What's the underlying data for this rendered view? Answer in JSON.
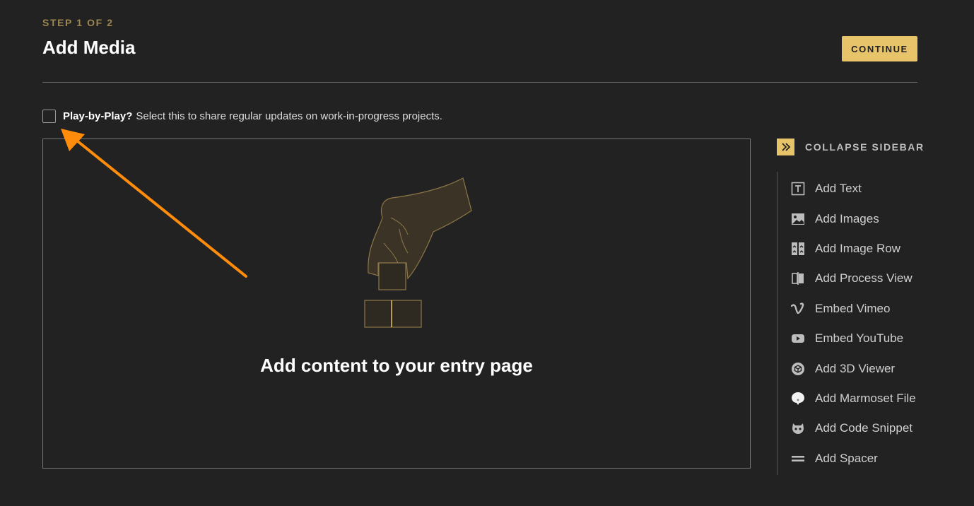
{
  "header": {
    "step": "STEP 1 OF 2",
    "title": "Add Media",
    "continue_label": "CONTINUE"
  },
  "play_by_play": {
    "label": "Play-by-Play?",
    "description": "Select this to share regular updates on work-in-progress projects.",
    "checked": false
  },
  "main": {
    "empty_text": "Add content to your entry page"
  },
  "sidebar": {
    "collapse_label": "COLLAPSE SIDEBAR",
    "items": [
      {
        "label": "Add Text",
        "icon": "text-icon"
      },
      {
        "label": "Add Images",
        "icon": "image-icon"
      },
      {
        "label": "Add Image Row",
        "icon": "image-row-icon"
      },
      {
        "label": "Add Process View",
        "icon": "process-view-icon"
      },
      {
        "label": "Embed Vimeo",
        "icon": "vimeo-icon"
      },
      {
        "label": "Embed YouTube",
        "icon": "youtube-icon"
      },
      {
        "label": "Add 3D Viewer",
        "icon": "3d-viewer-icon"
      },
      {
        "label": "Add Marmoset File",
        "icon": "marmoset-icon"
      },
      {
        "label": "Add Code Snippet",
        "icon": "code-snippet-icon"
      },
      {
        "label": "Add Spacer",
        "icon": "spacer-icon"
      }
    ]
  },
  "colors": {
    "background": "#222222",
    "accent": "#e7c469",
    "step_text": "#9c8652",
    "annotation_arrow": "#ff8c0a"
  }
}
